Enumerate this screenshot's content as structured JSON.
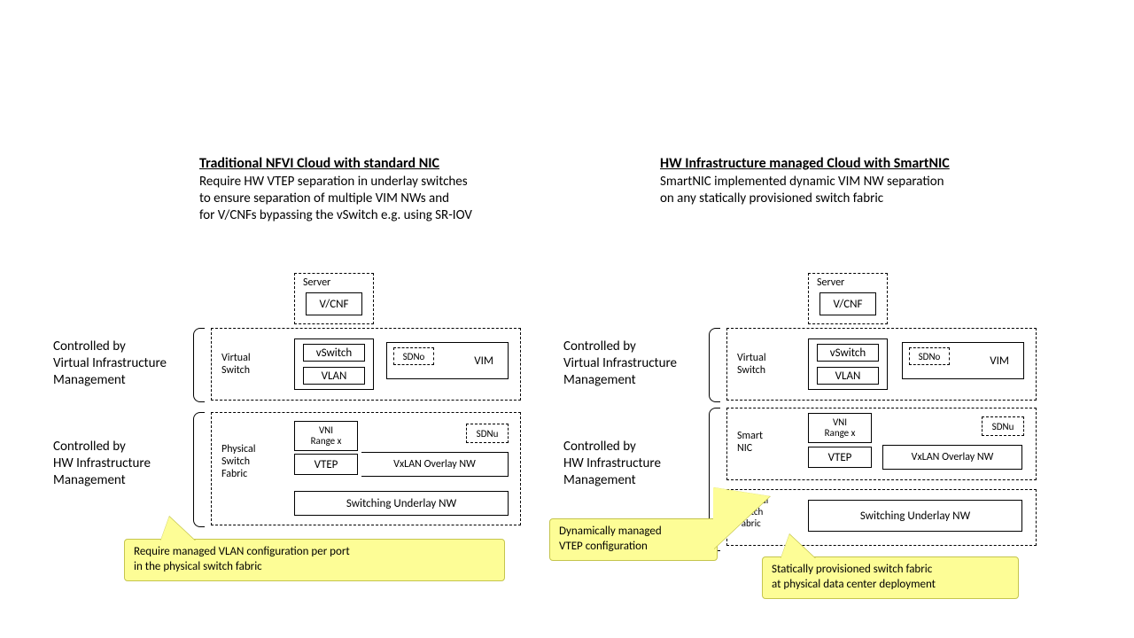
{
  "left": {
    "title": "Traditional NFVI Cloud with standard NIC",
    "subtitle": "Require HW VTEP separation in underlay switches\nto ensure separation of multiple VIM NWs and\nfor V/CNFs bypassing the vSwitch e.g. using SR-IOV",
    "side_upper": "Controlled by\nVirtual Infrastructure\nManagement",
    "side_lower": "Controlled by\nHW Infrastructure\nManagement",
    "server_label": "Server",
    "vcnf": "V/CNF",
    "vswitch_group": "Virtual\nSwitch",
    "vswitch": "vSwitch",
    "vlan": "VLAN",
    "sdno": "SDNo",
    "vim": "VIM",
    "psf_label": "Physical\nSwitch\nFabric",
    "vni": "VNI\nRange x",
    "vtep": "VTEP",
    "vxlan": "VxLAN Overlay NW",
    "sdnu": "SDNu",
    "underlay": "Switching Underlay NW",
    "callout": "Require managed VLAN configuration per port\nin the physical switch fabric"
  },
  "right": {
    "title": "HW Infrastructure managed Cloud with SmartNIC",
    "subtitle": "SmartNIC implemented dynamic VIM NW separation\non any statically provisioned switch fabric",
    "side_upper": "Controlled by\nVirtual Infrastructure\nManagement",
    "side_lower": "Controlled by\nHW Infrastructure\nManagement",
    "server_label": "Server",
    "vcnf": "V/CNF",
    "vswitch_group": "Virtual\nSwitch",
    "vswitch": "vSwitch",
    "vlan": "VLAN",
    "sdno": "SDNo",
    "vim": "VIM",
    "smartnic_label": "Smart\nNIC",
    "vni": "VNI\nRange x",
    "vtep": "VTEP",
    "vxlan": "VxLAN Overlay NW",
    "sdnu": "SDNu",
    "psf_label": "Physical\nSwitch\nFabric",
    "underlay": "Switching Underlay NW",
    "callout_left": "Dynamically managed\nVTEP configuration",
    "callout_right": "Statically provisioned switch fabric\nat physical data center deployment"
  }
}
